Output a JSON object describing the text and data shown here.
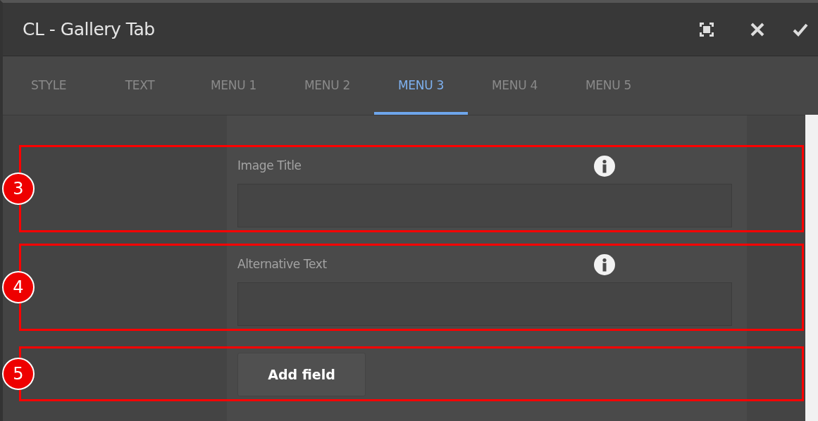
{
  "window": {
    "title": "CL - Gallery Tab"
  },
  "tabs": [
    {
      "label": "STYLE",
      "selected": false
    },
    {
      "label": "TEXT",
      "selected": false
    },
    {
      "label": "MENU 1",
      "selected": false
    },
    {
      "label": "MENU 2",
      "selected": false
    },
    {
      "label": "MENU 3",
      "selected": true
    },
    {
      "label": "MENU 4",
      "selected": false
    },
    {
      "label": "MENU 5",
      "selected": false
    }
  ],
  "sections": [
    {
      "kind": "field",
      "annotation": "3",
      "label": "Image Title"
    },
    {
      "kind": "field",
      "annotation": "4",
      "label": "Alternative Text"
    },
    {
      "kind": "button",
      "annotation": "5",
      "label": "Add field"
    }
  ]
}
